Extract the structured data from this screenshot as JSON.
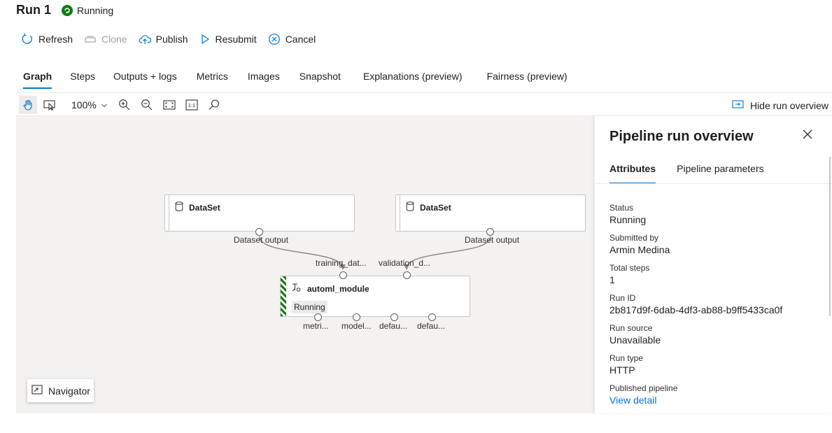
{
  "header": {
    "title": "Run 1",
    "status": "Running"
  },
  "toolbar": {
    "refresh": "Refresh",
    "clone": "Clone",
    "publish": "Publish",
    "resubmit": "Resubmit",
    "cancel": "Cancel"
  },
  "tabs": [
    {
      "label": "Graph",
      "active": true
    },
    {
      "label": "Steps"
    },
    {
      "label": "Outputs + logs"
    },
    {
      "label": "Metrics"
    },
    {
      "label": "Images"
    },
    {
      "label": "Snapshot"
    },
    {
      "label": "Explanations (preview)"
    },
    {
      "label": "Fairness (preview)"
    }
  ],
  "canvas_toolbar": {
    "zoom": "100%",
    "hide_overview": "Hide run overview",
    "fit_label": "1:1"
  },
  "graph": {
    "dataset1": {
      "title": "DataSet",
      "port_label": "Dataset output"
    },
    "dataset2": {
      "title": "DataSet",
      "port_label": "Dataset output"
    },
    "automl": {
      "title": "automl_module",
      "status": "Running",
      "inputs": [
        "training_dat...",
        "validation_d..."
      ],
      "outputs": [
        "metri...",
        "model...",
        "defau...",
        "defau..."
      ]
    },
    "navigator": "Navigator"
  },
  "panel": {
    "title": "Pipeline run overview",
    "tabs": [
      "Attributes",
      "Pipeline parameters"
    ],
    "attributes": [
      {
        "label": "Status",
        "value": "Running"
      },
      {
        "label": "Submitted by",
        "value": "Armin Medina"
      },
      {
        "label": "Total steps",
        "value": "1"
      },
      {
        "label": "Run ID",
        "value": "2b817d9f-6dab-4df3-ab88-b9ff5433ca0f"
      },
      {
        "label": "Run source",
        "value": "Unavailable"
      },
      {
        "label": "Run type",
        "value": "HTTP"
      },
      {
        "label": "Published pipeline",
        "value": "View detail"
      }
    ]
  },
  "colors": {
    "accent": "#0078d4",
    "running": "#107c10"
  }
}
